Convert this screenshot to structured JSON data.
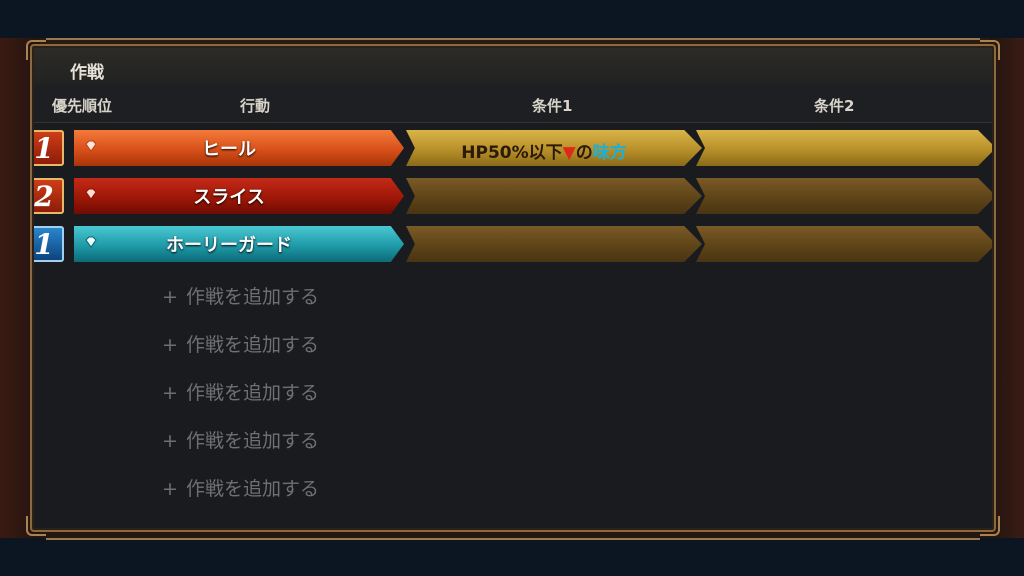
{
  "panel": {
    "title": "作戦",
    "headers": {
      "priority": "優先順位",
      "action": "行動",
      "condition1": "条件1",
      "condition2": "条件2"
    }
  },
  "rows": [
    {
      "rank": "1",
      "rank_color": "#c8381a",
      "action": "ヒール",
      "action_color": "#e8642a",
      "condition1": {
        "prefix": "HP50%以下",
        "marker": "▼",
        "middle": "の",
        "target": "味方"
      },
      "condition2": ""
    },
    {
      "rank": "2",
      "rank_color": "#c8381a",
      "action": "スライス",
      "action_color": "#b01e10",
      "condition1": "",
      "condition2": ""
    },
    {
      "rank": "1",
      "rank_color": "#1e6fb8",
      "action": "ホーリーガード",
      "action_color": "#2aa6b4",
      "condition1": "",
      "condition2": ""
    }
  ],
  "add_items": [
    {
      "icon": "plus-icon",
      "label": "作戦を追加する"
    },
    {
      "icon": "plus-icon",
      "label": "作戦を追加する"
    },
    {
      "icon": "plus-icon",
      "label": "作戦を追加する"
    },
    {
      "icon": "plus-icon",
      "label": "作戦を追加する"
    },
    {
      "icon": "plus-icon",
      "label": "作戦を追加する"
    }
  ]
}
